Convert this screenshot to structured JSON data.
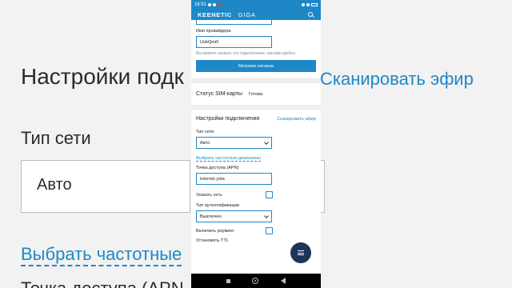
{
  "background": {
    "title": "Настройки подк",
    "scan": "Сканировать эфир",
    "net_type": "Тип сети",
    "auto": "Авто",
    "link": "Выбрать частотные",
    "apn": "Точка доступа (APN"
  },
  "status_bar": {
    "time": "16:51"
  },
  "app_bar": {
    "brand": "KEENETIC",
    "model": "GIGA",
    "search_icon": "search-icon"
  },
  "provider": {
    "label": "Имя провайдера",
    "value": "UsbQmi0",
    "hint": "Вы можете назвать это подключение, как вам удобно."
  },
  "signal_button": "Метрики сигнала",
  "sim": {
    "label": "Статус SIM-карты",
    "status": "Готова"
  },
  "connection": {
    "title": "Настройки подключения",
    "scan_link": "Сканировать эфир",
    "net_type_label": "Тип сети",
    "net_type_value": "Авто",
    "freq_link": "Выбрать частотные диапазоны",
    "apn_label": "Точка доступа (APN)",
    "apn_value": "internet.yota",
    "specify_network": "Указать сеть",
    "auth_label": "Тип аутентификации",
    "auth_value": "Выключен",
    "roaming": "Включить роуминг",
    "ttl": "Установить TTL"
  },
  "colors": {
    "accent": "#1e88c7",
    "fab": "#1a3556"
  }
}
